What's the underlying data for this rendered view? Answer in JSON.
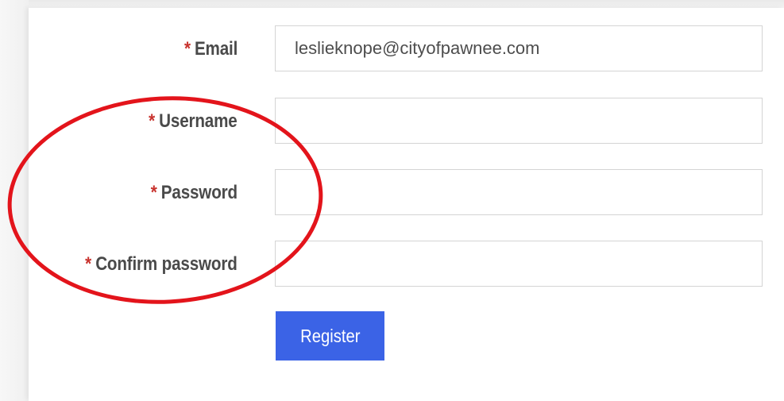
{
  "form": {
    "fields": [
      {
        "label": "Email",
        "required_mark": "*",
        "value": "leslieknope@cityofpawnee.com"
      },
      {
        "label": "Username",
        "required_mark": "*",
        "value": ""
      },
      {
        "label": "Password",
        "required_mark": "*",
        "value": ""
      },
      {
        "label": "Confirm password",
        "required_mark": "*",
        "value": ""
      }
    ],
    "submit_label": "Register"
  },
  "colors": {
    "required_mark": "#c8322d",
    "button_bg": "#3b63e6",
    "annotation_ellipse": "#e3141b"
  },
  "annotation": {
    "shape": "ellipse",
    "encircles": [
      "Username",
      "Password",
      "Confirm password"
    ]
  }
}
